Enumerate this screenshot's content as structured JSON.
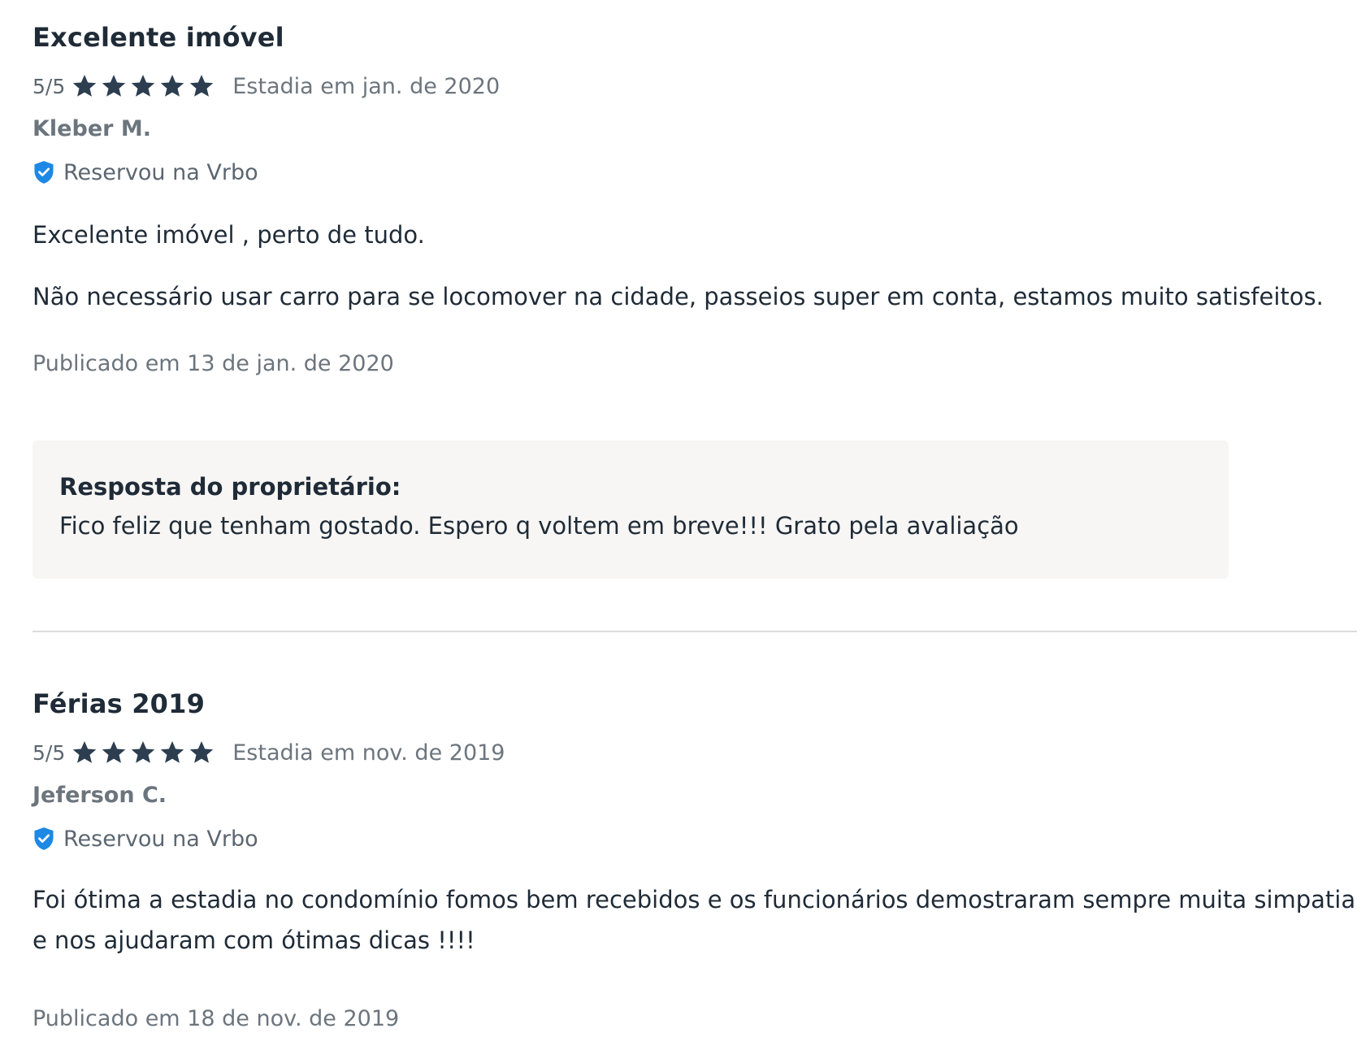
{
  "reviews": [
    {
      "title": "Excelente imóvel",
      "score": "5/5",
      "rating": 5,
      "rating_max": 5,
      "stay": "Estadia em jan. de 2020",
      "author": "Kleber M.",
      "booked_label": "Reservou na Vrbo",
      "body": [
        "Excelente imóvel , perto de tudo.",
        "Não necessário usar carro para se locomover na cidade, passeios super em conta, estamos muito satisfeitos."
      ],
      "published": "Publicado em 13 de jan. de 2020",
      "owner_response": {
        "title": "Resposta do proprietário:",
        "text": "Fico feliz que tenham gostado. Espero q voltem em breve!!! Grato pela avaliação"
      }
    },
    {
      "title": "Férias 2019",
      "score": "5/5",
      "rating": 5,
      "rating_max": 5,
      "stay": "Estadia em nov. de 2019",
      "author": "Jeferson C.",
      "booked_label": "Reservou na Vrbo",
      "body": [
        "Foi ótima a estadia no condomínio fomos bem recebidos e os funcionários demostraram sempre muita simpatia e nos ajudaram com ótimas dicas !!!!"
      ],
      "published": "Publicado em 18 de nov. de 2019"
    }
  ],
  "icons": {
    "star": "star-icon",
    "verified": "verified-shield-icon"
  },
  "colors": {
    "star": "#2c3e50",
    "verified": "#1e88e5",
    "text_primary": "#1f2b37",
    "text_muted": "#6c757d",
    "response_bg": "#f7f6f4",
    "divider": "#dcdcdc"
  }
}
